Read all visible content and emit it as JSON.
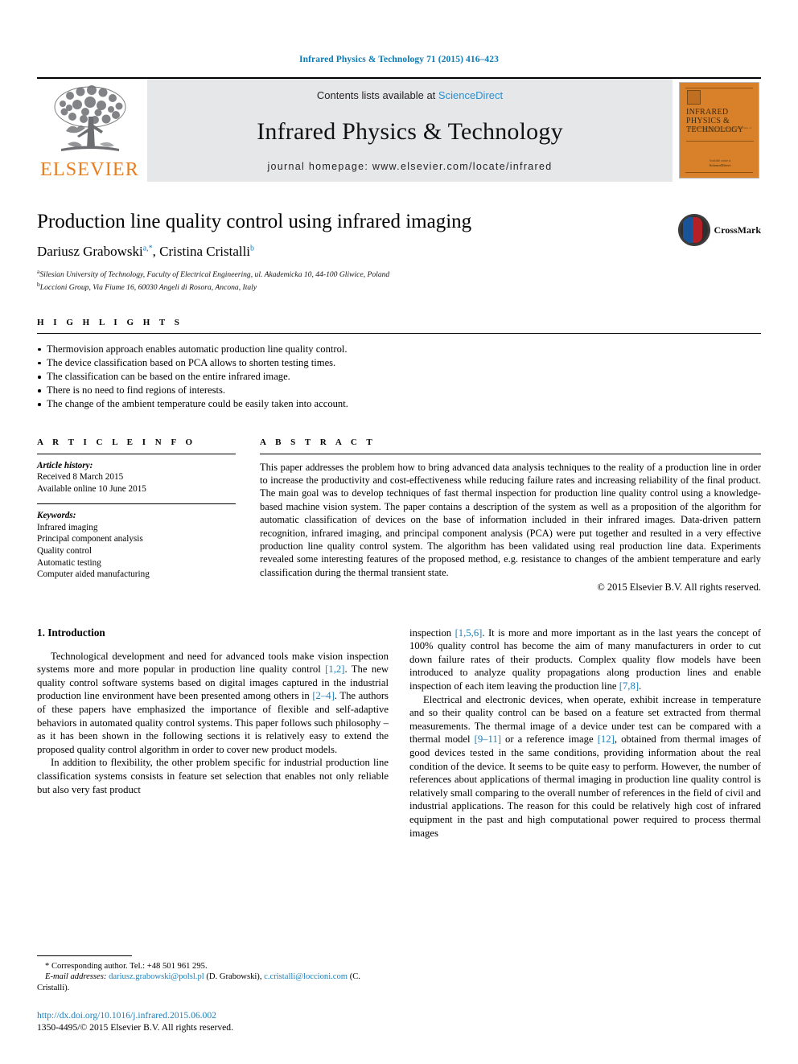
{
  "running_head": "Infrared Physics & Technology 71 (2015) 416–423",
  "masthead": {
    "contents_prefix": "Contents lists available at",
    "sciencedirect": "ScienceDirect",
    "journal_title": "Infrared Physics & Technology",
    "homepage": "journal homepage: www.elsevier.com/locate/infrared",
    "publisher_wordmark": "ELSEVIER",
    "cover": {
      "title": "INFRARED PHYSICS & TECHNOLOGY",
      "subtitle": "an international journal for the science and application of infrared and terahertz radiation",
      "footer_small": "Available online at",
      "footer_brand": "ScienceDirect"
    }
  },
  "article": {
    "title": "Production line quality control using infrared imaging",
    "authors": [
      {
        "name": "Dariusz Grabowski",
        "marks": "a,*"
      },
      {
        "name": "Cristina Cristalli",
        "marks": "b"
      }
    ],
    "authors_separator": ", ",
    "affiliations": [
      {
        "label": "a",
        "text": "Silesian University of Technology, Faculty of Electrical Engineering, ul. Akademicka 10, 44-100 Gliwice, Poland"
      },
      {
        "label": "b",
        "text": "Loccioni Group, Via Fiume 16, 60030 Angeli di Rosora, Ancona, Italy"
      }
    ],
    "crossmark_label": "CrossMark"
  },
  "highlights": {
    "heading": "H I G H L I G H T S",
    "items": [
      "Thermovision approach enables automatic production line quality control.",
      "The device classification based on PCA allows to shorten testing times.",
      "The classification can be based on the entire infrared image.",
      "There is no need to find regions of interests.",
      "The change of the ambient temperature could be easily taken into account."
    ]
  },
  "article_info": {
    "heading": "A R T I C L E   I N F O",
    "history_label": "Article history:",
    "history": [
      "Received 8 March 2015",
      "Available online 10 June 2015"
    ],
    "keywords_label": "Keywords:",
    "keywords": [
      "Infrared imaging",
      "Principal component analysis",
      "Quality control",
      "Automatic testing",
      "Computer aided manufacturing"
    ]
  },
  "abstract": {
    "heading": "A B S T R A C T",
    "text": "This paper addresses the problem how to bring advanced data analysis techniques to the reality of a production line in order to increase the productivity and cost-effectiveness while reducing failure rates and increasing reliability of the final product. The main goal was to develop techniques of fast thermal inspection for production line quality control using a knowledge-based machine vision system. The paper contains a description of the system as well as a proposition of the algorithm for automatic classification of devices on the base of information included in their infrared images. Data-driven pattern recognition, infrared imaging, and principal component analysis (PCA) were put together and resulted in a very effective production line quality control system. The algorithm has been validated using real production line data. Experiments revealed some interesting features of the proposed method, e.g. resistance to changes of the ambient temperature and early classification during the thermal transient state.",
    "copyright": "© 2015 Elsevier B.V. All rights reserved."
  },
  "introduction": {
    "heading": "1. Introduction",
    "left_paragraphs": [
      {
        "segments": [
          {
            "t": "Technological development and need for advanced tools make vision inspection systems more and more popular in production line quality control "
          },
          {
            "t": "[1,2]",
            "ref": true
          },
          {
            "t": ". The new quality control software systems based on digital images captured in the industrial production line environment have been presented among others in "
          },
          {
            "t": "[2–4]",
            "ref": true
          },
          {
            "t": ". The authors of these papers have emphasized the importance of flexible and self-adaptive behaviors in automated quality control systems. This paper follows such philosophy – as it has been shown in the following sections it is relatively easy to extend the proposed quality control algorithm in order to cover new product models."
          }
        ]
      },
      {
        "segments": [
          {
            "t": "In addition to flexibility, the other problem specific for industrial production line classification systems consists in feature set selection that enables not only reliable but also very fast product"
          }
        ]
      }
    ],
    "right_paragraphs": [
      {
        "segments": [
          {
            "t": "inspection "
          },
          {
            "t": "[1,5,6]",
            "ref": true
          },
          {
            "t": ". It is more and more important as in the last years the concept of 100% quality control has become the aim of many manufacturers in order to cut down failure rates of their products. Complex quality flow models have been introduced to analyze quality propagations along production lines and enable inspection of each item leaving the production line "
          },
          {
            "t": "[7,8]",
            "ref": true
          },
          {
            "t": "."
          }
        ]
      },
      {
        "segments": [
          {
            "t": "Electrical and electronic devices, when operate, exhibit increase in temperature and so their quality control can be based on a feature set extracted from thermal measurements. The thermal image of a device under test can be compared with a thermal model "
          },
          {
            "t": "[9–11]",
            "ref": true
          },
          {
            "t": " or a reference image "
          },
          {
            "t": "[12]",
            "ref": true
          },
          {
            "t": ", obtained from thermal images of good devices tested in the same conditions, providing information about the real condition of the device. It seems to be quite easy to perform. However, the number of references about applications of thermal imaging in production line quality control is relatively small comparing to the overall number of references in the field of civil and industrial applications. The reason for this could be relatively high cost of infrared equipment in the past and high computational power required to process thermal images"
          }
        ]
      }
    ]
  },
  "footnotes": {
    "corresponding": "* Corresponding author. Tel.: +48 501 961 295.",
    "email_label": "E-mail addresses:",
    "emails": [
      {
        "address": "dariusz.grabowski@polsl.pl",
        "owner": "(D. Grabowski)"
      },
      {
        "address": "c.cristalli@loccioni.com",
        "owner": "(C. Cristalli)."
      }
    ],
    "doi": "http://dx.doi.org/10.1016/j.infrared.2015.06.002",
    "issn": "1350-4495/© 2015 Elsevier B.V. All rights reserved."
  },
  "colors": {
    "link": "#1b7fbb",
    "sciencedirect": "#2b8fd0",
    "elsevier_orange": "#e87d1e",
    "masthead_bg": "#e6e7e8",
    "cover_orange": "#d9812a"
  }
}
